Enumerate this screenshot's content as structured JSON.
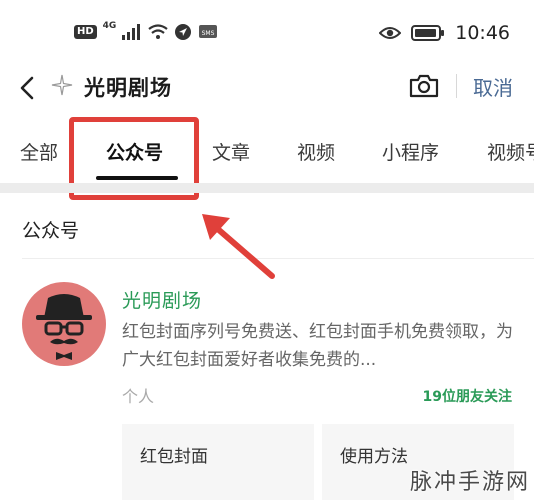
{
  "status_bar": {
    "hd_label": "HD",
    "network_label": "4G",
    "time": "10:46"
  },
  "header": {
    "query": "光明剧场",
    "cancel_label": "取消"
  },
  "tabs": [
    {
      "label": "全部",
      "active": false
    },
    {
      "label": "公众号",
      "active": true
    },
    {
      "label": "文章",
      "active": false
    },
    {
      "label": "视频",
      "active": false
    },
    {
      "label": "小程序",
      "active": false
    },
    {
      "label": "视频号",
      "active": false
    }
  ],
  "section": {
    "title": "公众号"
  },
  "result": {
    "name": "光明剧场",
    "description": "红包封面序列号免费送、红包封面手机免费领取，为广大红包封面爱好者收集免费的...",
    "type": "个人",
    "friends_following": "19位朋友关注",
    "menu": [
      "红包封面",
      "使用方法"
    ]
  },
  "watermark": "脉冲手游网",
  "colors": {
    "accent_green": "#2a9a57",
    "highlight_red": "#e0403a",
    "link_blue": "#4a6a94",
    "avatar_bg": "#e17a78"
  }
}
